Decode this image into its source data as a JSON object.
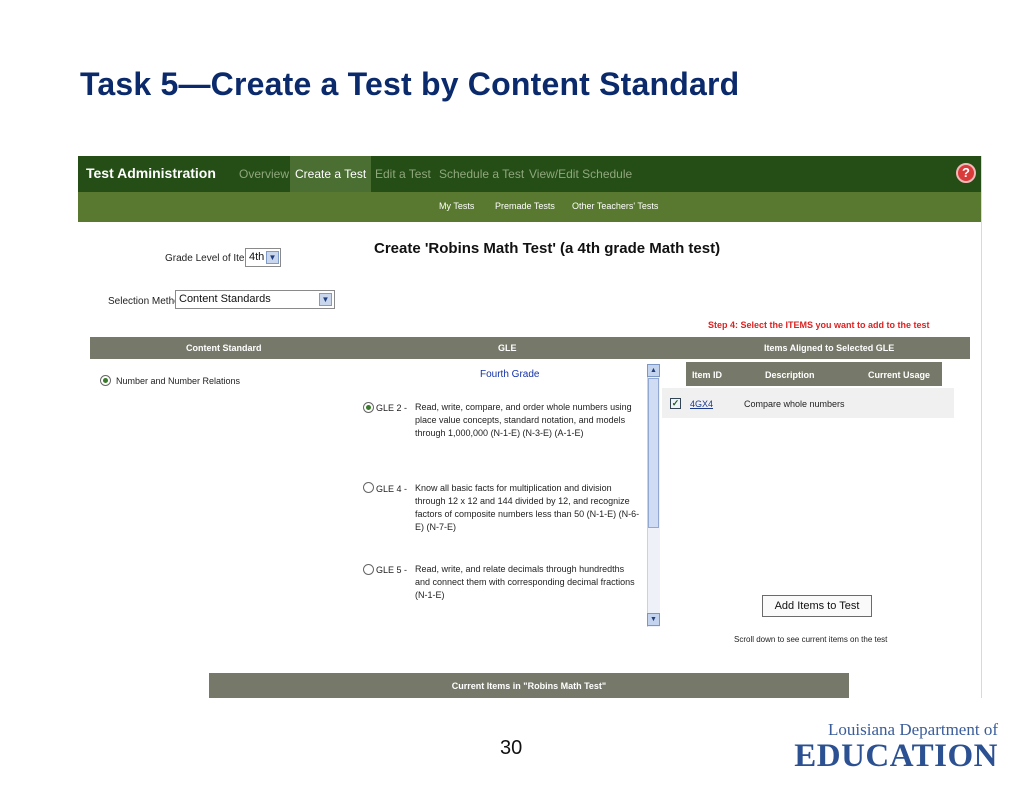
{
  "slide": {
    "title": "Task 5—Create a Test by Content Standard",
    "page_number": "30",
    "logo": {
      "line1": "Louisiana Department of",
      "line2": "EDUCATION"
    }
  },
  "app": {
    "title": "Test Administration",
    "nav_tabs": [
      {
        "label": "Overview",
        "active": false
      },
      {
        "label": "Create a Test",
        "active": true
      },
      {
        "label": "Edit a Test",
        "active": false
      },
      {
        "label": "Schedule a Test",
        "active": false
      },
      {
        "label": "View/Edit Schedule",
        "active": false
      }
    ],
    "help_icon": "?",
    "sub_tabs": [
      "My Tests",
      "Premade Tests",
      "Other Teachers' Tests"
    ],
    "colors": {
      "nav_dark": "#254d16",
      "nav_sub": "#58792f",
      "header_gray": "#76796a",
      "step_red": "#dd2222"
    }
  },
  "form": {
    "grade_label": "Grade Level of Items:",
    "grade_value": "4th",
    "method_label": "Selection Method:",
    "method_value": "Content Standards",
    "heading": "Create 'Robins Math Test' (a 4th grade Math test)",
    "step_hint": "Step 4: Select the ITEMS you want to add to the test"
  },
  "columns": {
    "content_standard": "Content Standard",
    "gle": "GLE",
    "items": "Items Aligned to Selected GLE"
  },
  "content_standards": [
    {
      "label": "Number and Number Relations",
      "selected": true
    }
  ],
  "gle": {
    "grade_heading": "Fourth Grade",
    "items": [
      {
        "code": "GLE 2 -",
        "text": "Read, write, compare, and order whole numbers using place value concepts, standard notation, and models through 1,000,000 (N-1-E) (N-3-E) (A-1-E)",
        "selected": true
      },
      {
        "code": "GLE 4 -",
        "text": "Know all basic facts for multiplication and division through 12 x 12 and 144 divided by 12, and recognize factors of composite numbers less than 50 (N-1-E) (N-6-E) (N-7-E)",
        "selected": false
      },
      {
        "code": "GLE 5 -",
        "text": "Read, write, and relate decimals through hundredths and connect them with corresponding decimal fractions (N-1-E)",
        "selected": false
      }
    ]
  },
  "items_table": {
    "headers": [
      "Item ID",
      "Description",
      "Current Usage"
    ],
    "rows": [
      {
        "checked": true,
        "id": "4GX4",
        "description": "Compare whole numbers",
        "usage": ""
      }
    ]
  },
  "actions": {
    "add_items": "Add Items to Test",
    "scroll_note": "Scroll down to see current items on the test"
  },
  "current_items_title": "Current Items in \"Robins Math Test\""
}
